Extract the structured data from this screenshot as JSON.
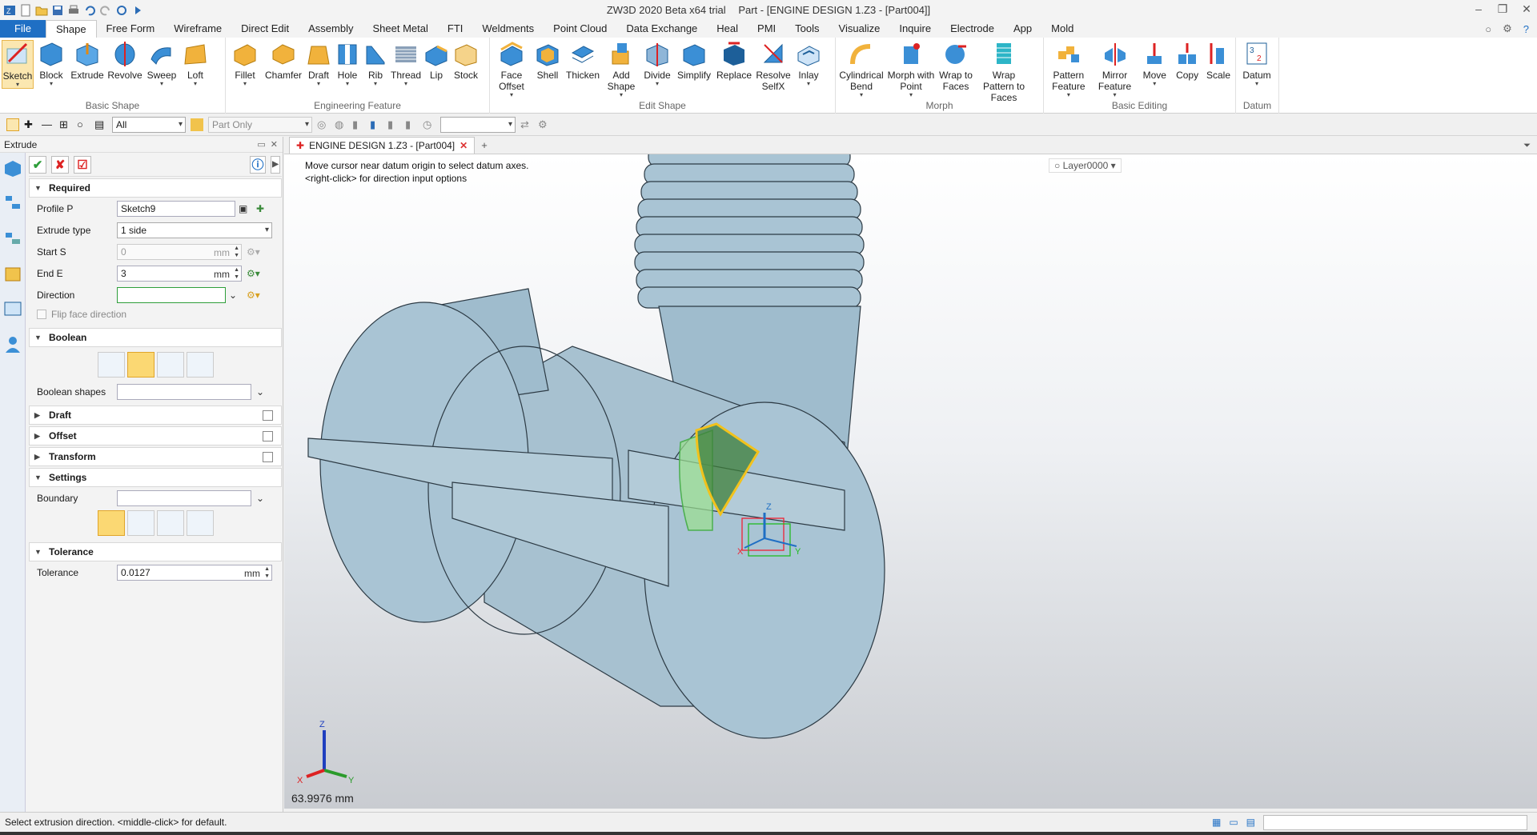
{
  "window": {
    "app_title": "ZW3D 2020 Beta x64 trial",
    "doc_title": "Part - [ENGINE DESIGN 1.Z3 - [Part004]]"
  },
  "menu": {
    "file": "File",
    "tabs": [
      "Shape",
      "Free Form",
      "Wireframe",
      "Direct Edit",
      "Assembly",
      "Sheet Metal",
      "FTI",
      "Weldments",
      "Point Cloud",
      "Data Exchange",
      "Heal",
      "PMI",
      "Tools",
      "Visualize",
      "Inquire",
      "Electrode",
      "App",
      "Mold"
    ]
  },
  "ribbon": {
    "basic_shape": {
      "label": "Basic Shape",
      "buttons": [
        "Sketch",
        "Block",
        "Extrude",
        "Revolve",
        "Sweep",
        "Loft"
      ]
    },
    "engineering_feature": {
      "label": "Engineering Feature",
      "buttons": [
        "Fillet",
        "Chamfer",
        "Draft",
        "Hole",
        "Rib",
        "Thread",
        "Lip",
        "Stock"
      ]
    },
    "edit_shape": {
      "label": "Edit Shape",
      "buttons": [
        "Face Offset",
        "Shell",
        "Thicken",
        "Add Shape",
        "Divide",
        "Simplify",
        "Replace",
        "Resolve SelfX",
        "Inlay"
      ]
    },
    "morph": {
      "label": "Morph",
      "buttons": [
        "Cylindrical Bend",
        "Morph with Point",
        "Wrap to Faces",
        "Wrap Pattern to Faces"
      ]
    },
    "basic_editing": {
      "label": "Basic Editing",
      "buttons": [
        "Pattern Feature",
        "Mirror Feature",
        "Move",
        "Copy",
        "Scale"
      ]
    },
    "datum": {
      "label": "Datum",
      "buttons": [
        "Datum"
      ]
    }
  },
  "toolbar": {
    "filter_value": "All",
    "scope_value": "Part Only"
  },
  "panel": {
    "title": "Extrude",
    "required": {
      "header": "Required",
      "profile_label": "Profile P",
      "profile_value": "Sketch9",
      "extrude_type_label": "Extrude type",
      "extrude_type_value": "1 side",
      "start_label": "Start S",
      "start_value": "0",
      "start_unit": "mm",
      "end_label": "End E",
      "end_value": "3",
      "end_unit": "mm",
      "direction_label": "Direction",
      "direction_value": "",
      "flip_label": "Flip face direction"
    },
    "boolean": {
      "header": "Boolean",
      "shapes_label": "Boolean shapes"
    },
    "draft_header": "Draft",
    "offset_header": "Offset",
    "transform_header": "Transform",
    "settings": {
      "header": "Settings",
      "boundary_label": "Boundary"
    },
    "tolerance": {
      "header": "Tolerance",
      "label": "Tolerance",
      "value": "0.0127",
      "unit": "mm"
    }
  },
  "document_tab": {
    "label": "ENGINE DESIGN 1.Z3 - [Part004]"
  },
  "viewport": {
    "hint_line1": "Move cursor near datum origin to select datum axes.",
    "hint_line2": "<right-click> for direction input options",
    "layer": "Layer0000",
    "distance_readout": "63.9976 mm",
    "axis_labels": {
      "x": "X",
      "y": "Y",
      "z": "Z"
    }
  },
  "status_bar": {
    "message": "Select extrusion direction. <middle-click> for default."
  },
  "colors": {
    "accent_blue": "#1f6fc4",
    "model_fill": "#a9c4d4",
    "highlight_green": "#2e9e3a",
    "highlight_yellow": "#f2c21c"
  }
}
